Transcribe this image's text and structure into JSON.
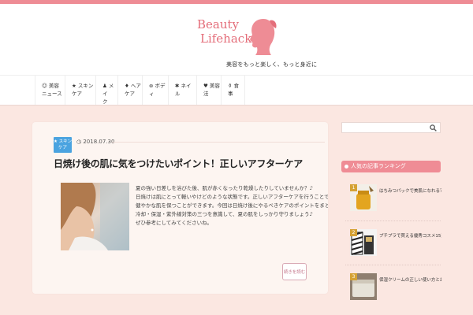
{
  "header": {
    "logo_line1": "Beauty",
    "logo_line2": "Lifehack",
    "tagline": "美容をもっと楽しく、もっと身近に"
  },
  "nav": {
    "items": [
      {
        "icon": "☺",
        "line1": "美容",
        "line2": "ニュース"
      },
      {
        "icon": "★",
        "line1": "スキン",
        "line2": "ケア"
      },
      {
        "icon": "♟",
        "line1": "メイ",
        "line2": "ク"
      },
      {
        "icon": "♦",
        "line1": "ヘア",
        "line2": "ケア"
      },
      {
        "icon": "⊛",
        "line1": "ボデ",
        "line2": "ィ"
      },
      {
        "icon": "✱",
        "line1": "ネイ",
        "line2": "ル"
      },
      {
        "icon": "♥",
        "line1": "美容",
        "line2": "法"
      },
      {
        "icon": "⚱",
        "line1": "食",
        "line2": "事"
      }
    ]
  },
  "post": {
    "category": "★ スキン ケア",
    "date": "2018.07.30",
    "title": "日焼け後の肌に気をつけたいポイント！正しいアフターケア",
    "excerpt": [
      "夏の強い日差しを浴びた後、肌が赤くなったり乾燥したりしていませんか？♪",
      "日焼けは肌にとって軽いやけどのような状態です。正しいアフターケアを行うことで、シミやくすみを防ぎ、",
      "健やかな肌を保つことができます。今回は日焼け後にやるべきケアのポイントをまとめました。",
      "冷却・保湿・紫外線対策の三つを意識して、夏の肌をしっかり守りましょう♪",
      "ぜひ参考にしてみてくださいね。"
    ],
    "more_label": "続きを読む"
  },
  "sidebar": {
    "search_placeholder": "",
    "widget_title": "人気の記事ランキング",
    "ranking": [
      {
        "rank": "1",
        "text": "はちみつパックで美肌になれる？230の効果"
      },
      {
        "rank": "2",
        "text": "プチプラで買える優秀コスメ15選！おすすめ"
      },
      {
        "rank": "3",
        "text": "保湿クリームの正しい使い方とおすすめ商品"
      }
    ]
  },
  "colors": {
    "accent": "#ee8c95",
    "background": "#fbe7e1",
    "badge": "#4aa3e0"
  }
}
